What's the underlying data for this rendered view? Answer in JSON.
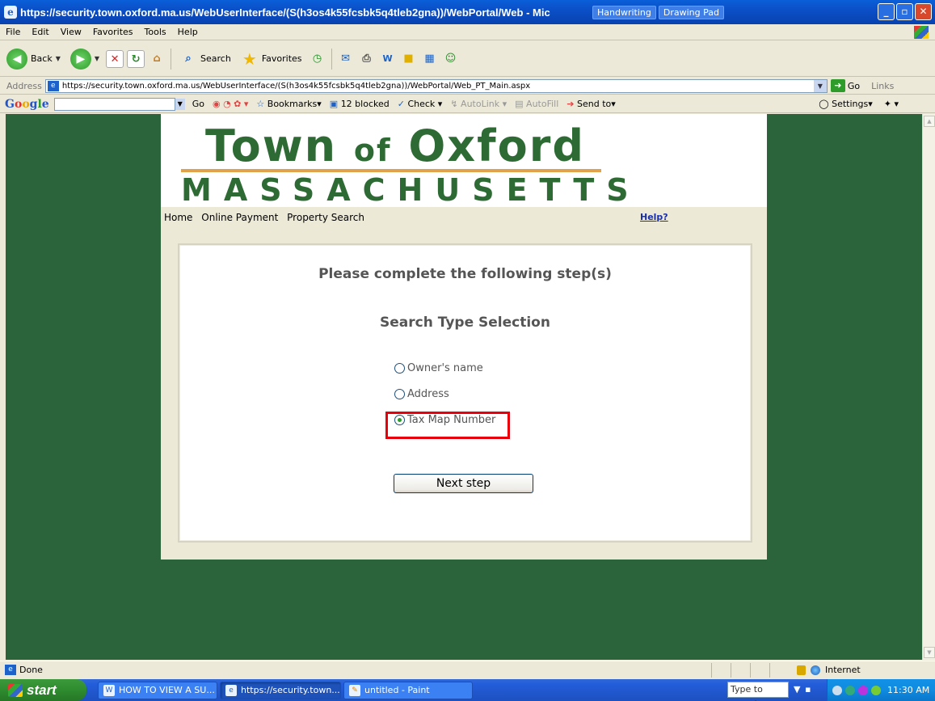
{
  "window": {
    "title": "https://security.town.oxford.ma.us/WebUserInterface/(S(h3os4k55fcsbk5q4tleb2gna))/WebPortal/Web - Mic",
    "ext_buttons": [
      "Handwriting",
      "Drawing Pad"
    ]
  },
  "menu": [
    "File",
    "Edit",
    "View",
    "Favorites",
    "Tools",
    "Help"
  ],
  "toolbar": {
    "back": "Back",
    "search": "Search",
    "favorites": "Favorites"
  },
  "address": {
    "label": "Address",
    "url": "https://security.town.oxford.ma.us/WebUserInterface/(S(h3os4k55fcsbk5q4tleb2gna))/WebPortal/Web_PT_Main.aspx",
    "go": "Go",
    "links": "Links"
  },
  "google_bar": {
    "go": "Go",
    "bookmarks": "Bookmarks",
    "blocked": "12 blocked",
    "check": "Check",
    "autolink": "AutoLink",
    "autofill": "AutoFill",
    "send_to": "Send to",
    "settings": "Settings"
  },
  "portal": {
    "town": "Town",
    "of": "of",
    "oxford": "Oxford",
    "state": "MASSACHUSETTS",
    "nav": [
      "Home",
      "Online Payment",
      "Property Search"
    ],
    "help": "Help?",
    "heading": "Please complete the following step(s)",
    "subheading": "Search Type Selection",
    "options": [
      {
        "label": "Owner's name",
        "selected": false
      },
      {
        "label": "Address",
        "selected": false
      },
      {
        "label": "Tax Map Number",
        "selected": true
      }
    ],
    "next_button": "Next step"
  },
  "status": {
    "text": "Done",
    "zone": "Internet"
  },
  "taskbar": {
    "start": "start",
    "tasks": [
      "HOW TO VIEW A SU...",
      "https://security.town...",
      "untitled - Paint"
    ],
    "search_placeholder": "Type to search",
    "clock": "11:30 AM"
  },
  "colors": {
    "page_background": "#2b633a",
    "brand_green": "#2e6b34",
    "gold_rule": "#e0a24a",
    "highlight_red": "#e8000b"
  }
}
